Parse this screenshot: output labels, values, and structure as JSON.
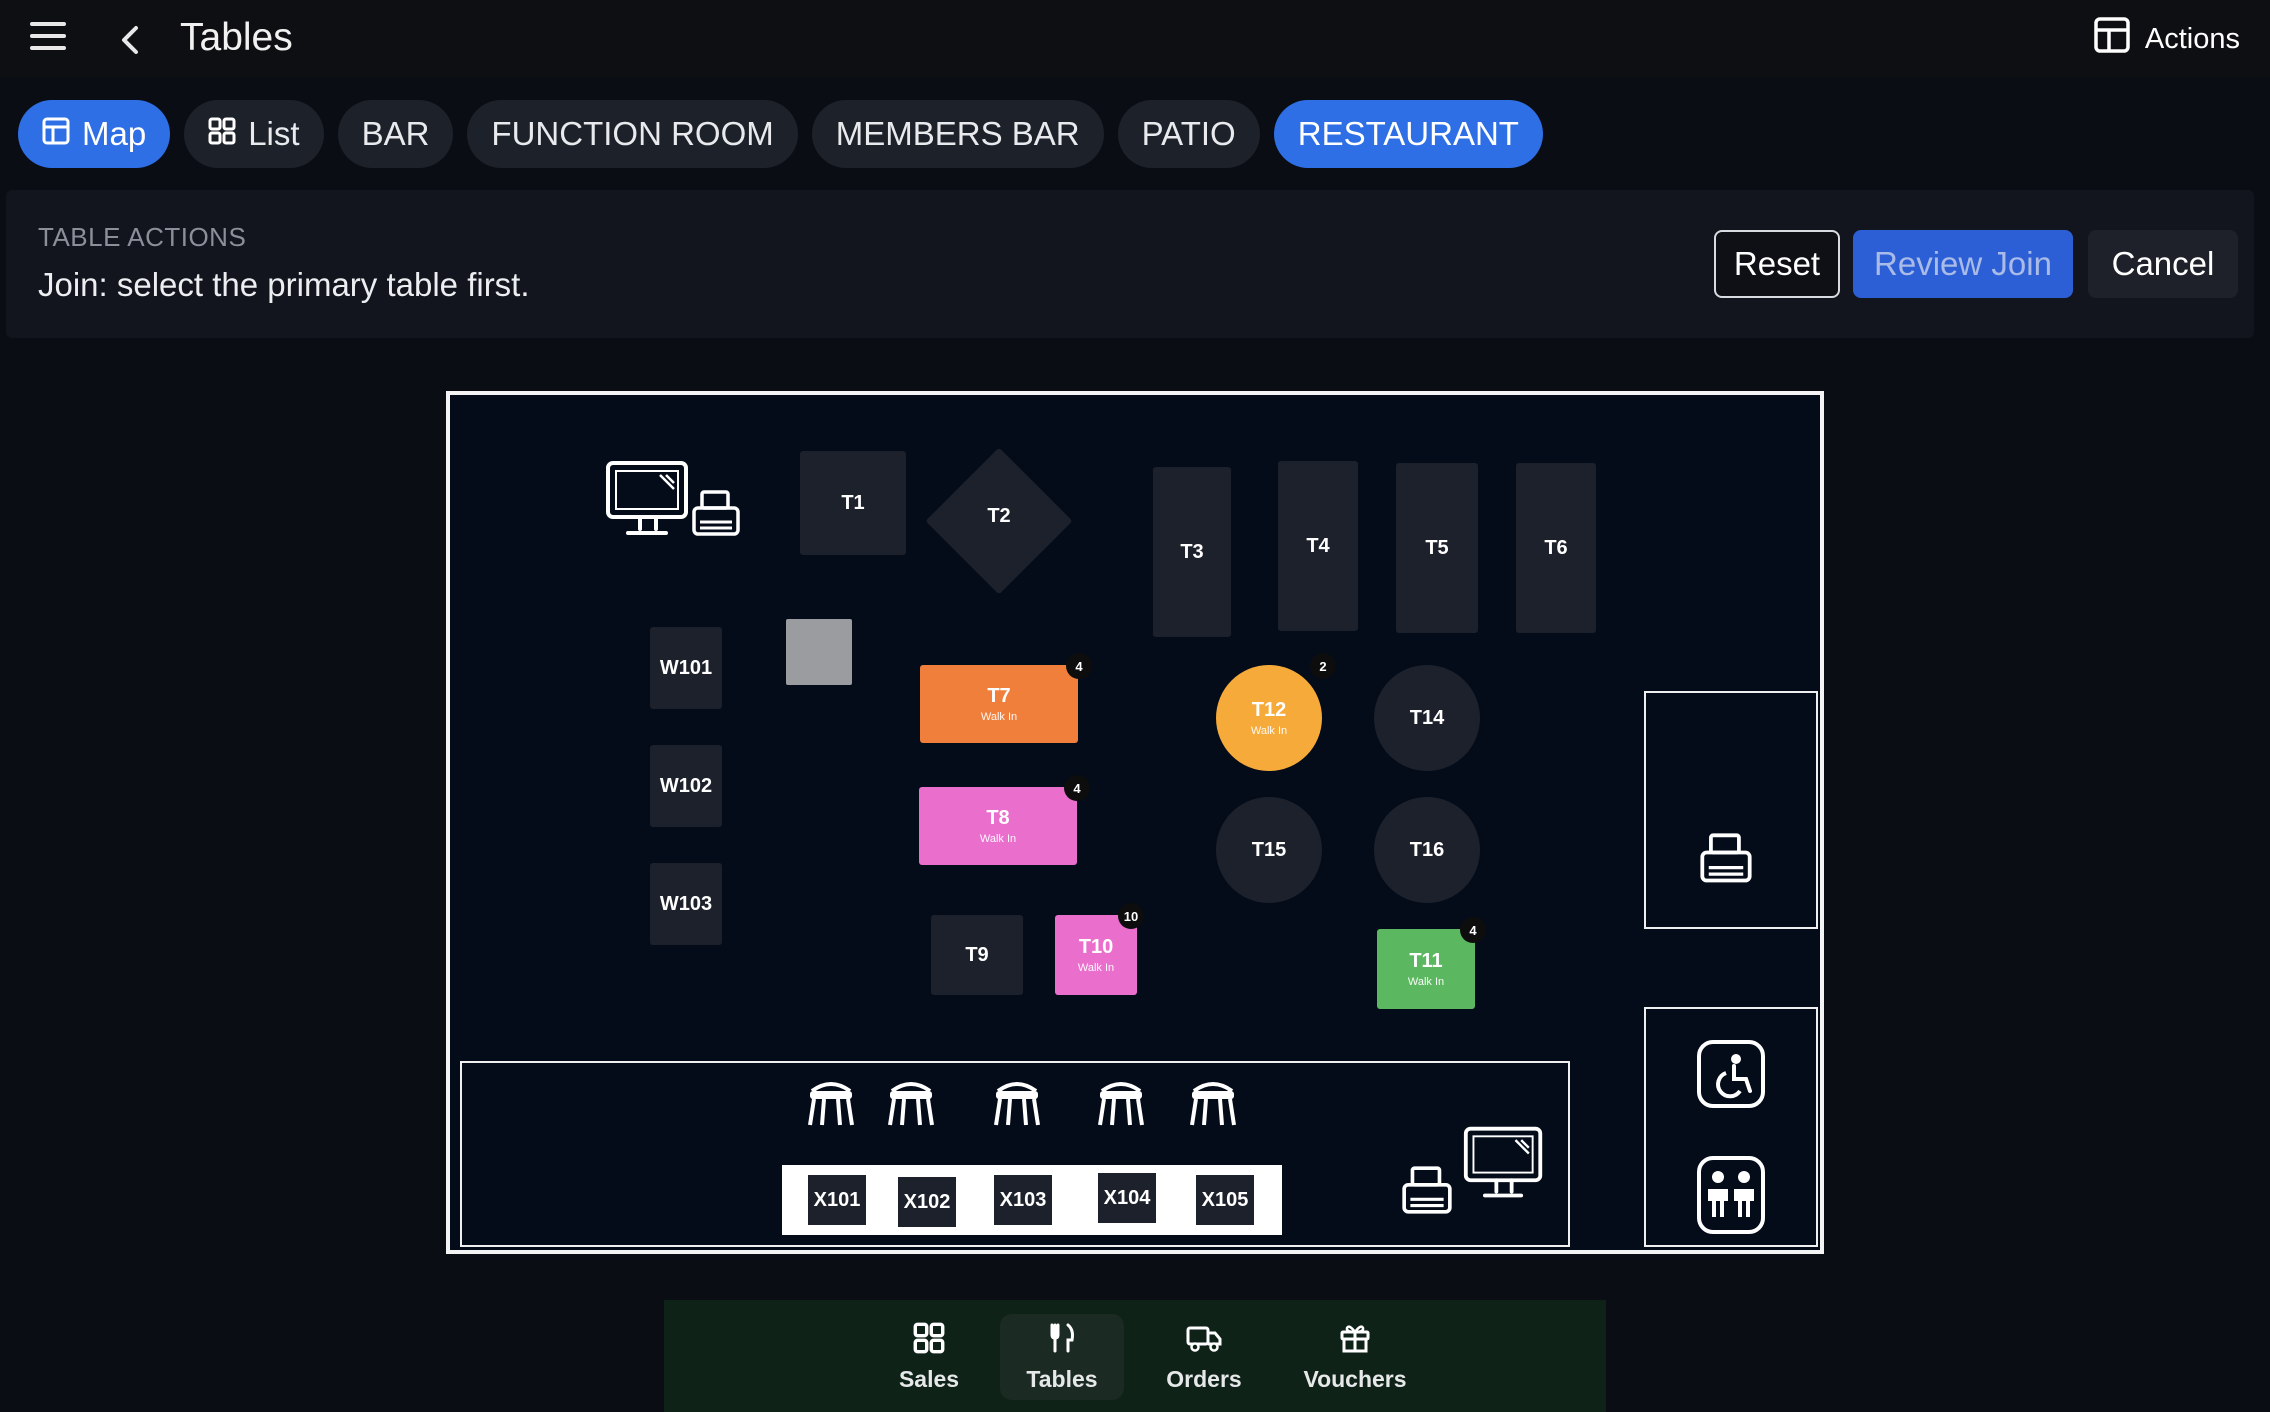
{
  "header": {
    "title": "Tables",
    "actions_label": "Actions"
  },
  "tabs": [
    {
      "label": "Map",
      "active": true
    },
    {
      "label": "List",
      "active": false
    },
    {
      "label": "BAR",
      "active": false
    },
    {
      "label": "FUNCTION ROOM",
      "active": false
    },
    {
      "label": "MEMBERS BAR",
      "active": false
    },
    {
      "label": "PATIO",
      "active": false
    },
    {
      "label": "RESTAURANT",
      "active": true
    }
  ],
  "table_actions": {
    "heading": "TABLE ACTIONS",
    "message": "Join: select the primary table first.",
    "reset_label": "Reset",
    "review_label": "Review Join",
    "cancel_label": "Cancel"
  },
  "tables": {
    "T1": {
      "label": "T1"
    },
    "T2": {
      "label": "T2"
    },
    "T3": {
      "label": "T3"
    },
    "T4": {
      "label": "T4"
    },
    "T5": {
      "label": "T5"
    },
    "T6": {
      "label": "T6"
    },
    "W101": {
      "label": "W101"
    },
    "W102": {
      "label": "W102"
    },
    "W103": {
      "label": "W103"
    },
    "T7": {
      "label": "T7",
      "status": "Walk In",
      "guests": "4",
      "color": "#f07f3b"
    },
    "T8": {
      "label": "T8",
      "status": "Walk In",
      "guests": "4",
      "color": "#ea6fcd"
    },
    "T9": {
      "label": "T9"
    },
    "T10": {
      "label": "T10",
      "status": "Walk In",
      "guests": "10",
      "color": "#ea6fcd"
    },
    "T11": {
      "label": "T11",
      "status": "Walk In",
      "guests": "4",
      "color": "#5cb860"
    },
    "T12": {
      "label": "T12",
      "status": "Walk In",
      "guests": "2",
      "color": "#f5aa3a"
    },
    "T14": {
      "label": "T14"
    },
    "T15": {
      "label": "T15"
    },
    "T16": {
      "label": "T16"
    },
    "X101": {
      "label": "X101"
    },
    "X102": {
      "label": "X102"
    },
    "X103": {
      "label": "X103"
    },
    "X104": {
      "label": "X104"
    },
    "X105": {
      "label": "X105"
    }
  },
  "bottom_nav": [
    {
      "label": "Sales",
      "icon": "grid-icon"
    },
    {
      "label": "Tables",
      "icon": "cutlery-icon",
      "active": true
    },
    {
      "label": "Orders",
      "icon": "delivery-truck-icon"
    },
    {
      "label": "Vouchers",
      "icon": "gift-icon"
    }
  ]
}
